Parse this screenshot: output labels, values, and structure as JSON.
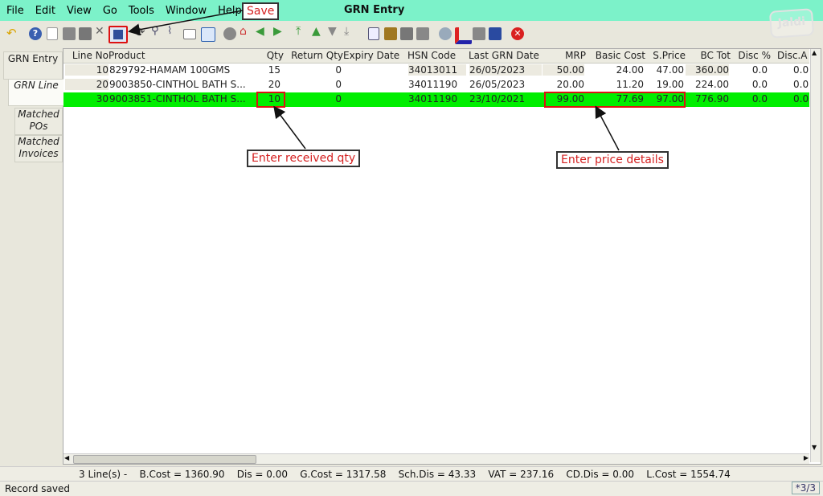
{
  "menu": {
    "file": "File",
    "edit": "Edit",
    "view": "View",
    "go": "Go",
    "tools": "Tools",
    "window": "Window",
    "help": "Help"
  },
  "window_title": "GRN Entry",
  "logo_text": "Jaldi",
  "callouts": {
    "save": "Save",
    "qty": "Enter received qty",
    "price": "Enter price details"
  },
  "tabs": [
    {
      "label": "GRN Entry"
    },
    {
      "label": "GRN Line"
    },
    {
      "label": "Matched POs"
    },
    {
      "label": "Matched Invoices"
    }
  ],
  "grid": {
    "columns": [
      "Line No",
      "Product",
      "Qty",
      "Return Qty",
      "Expiry Date",
      "HSN Code",
      "Last GRN Date",
      "MRP",
      "Basic Cost",
      "S.Price",
      "BC Tot",
      "Disc %",
      "Disc.A"
    ],
    "rows": [
      {
        "line": "10",
        "product": "829792-HAMAM 100GMS",
        "qty": "15",
        "return_qty": "0",
        "expiry": "",
        "hsn": "34013011",
        "last_grn": "26/05/2023",
        "mrp": "50.00",
        "basic_cost": "24.00",
        "sprice": "47.00",
        "bc_tot": "360.00",
        "disc_pct": "0.0",
        "disc_a": "0.0"
      },
      {
        "line": "20",
        "product": "9003850-CINTHOL BATH S...",
        "qty": "20",
        "return_qty": "0",
        "expiry": "",
        "hsn": "34011190",
        "last_grn": "26/05/2023",
        "mrp": "20.00",
        "basic_cost": "11.20",
        "sprice": "19.00",
        "bc_tot": "224.00",
        "disc_pct": "0.0",
        "disc_a": "0.0"
      },
      {
        "line": "30",
        "product": "9003851-CINTHOL BATH S...",
        "qty": "10",
        "return_qty": "0",
        "expiry": "",
        "hsn": "34011190",
        "last_grn": "23/10/2021",
        "mrp": "99.00",
        "basic_cost": "77.69",
        "sprice": "97.00",
        "bc_tot": "776.90",
        "disc_pct": "0.0",
        "disc_a": "0.0"
      }
    ]
  },
  "summary": "3 Line(s) -    B.Cost = 1360.90    Dis = 0.00    G.Cost = 1317.58    Sch.Dis = 43.33    VAT = 237.16    CD.Dis = 0.00    L.Cost = 1554.74",
  "status": {
    "text": "Record saved",
    "count": "*3/3"
  },
  "colors": {
    "menubar": "#7cf2c9",
    "selected_row": "#00ee00",
    "annotation": "#d42020"
  }
}
